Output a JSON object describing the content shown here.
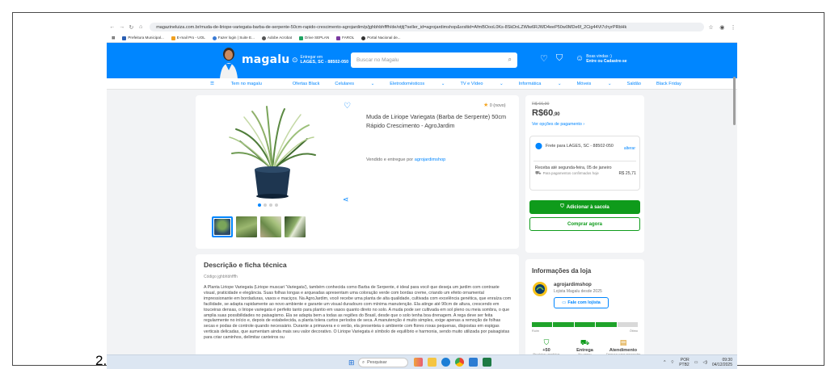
{
  "list_number": "2.",
  "browser": {
    "url": "magazineluiza.com.br/muda-de-liriope-variegata-barba-de-serpente-50cm-rapido-crescimento-agrojardim/p/jghbhbhfffh/de/otjtj?seller_id=agrojardimshop&srsltid=AfmBOooL0Ks-8SkDnLZWlw6RJWD4eeP50w0MDe6f_2Cig44Vi7chyrPRbHk",
    "bookmarks": [
      "Prefeitura Municipal...",
      "E-mail Pro - UOL",
      "Fazer login | Suite E...",
      "Adobe Acrobat",
      "Drive SEPLAN",
      "FAROL",
      "Portal Nacional de..."
    ]
  },
  "header": {
    "logo": "magalu",
    "deliver_label": "Entregar em",
    "deliver_location": "LAGES, SC - 88502-050",
    "search_placeholder": "Buscar no Magalu",
    "login_greeting": "Boas vindas :)",
    "login_action": "Entre ou Cadastre-se"
  },
  "nav": {
    "items": [
      "Tem no magalu",
      "Ofertas Black",
      "Celulares",
      "Eletrodomésticos",
      "TV e Vídeo",
      "Informática",
      "Móveis",
      "Saldão",
      "Black Friday"
    ]
  },
  "product": {
    "title": "Muda de Liriope Variegata (Barba de Serpente) 50cm Rápido Crescimento - AgroJardim",
    "rating": "0 (novo)",
    "seller_prefix": "Vendido e entregue por",
    "seller_name": "agrojardimshop"
  },
  "price": {
    "old": "R$ 66,90",
    "main": "R$60",
    "cents": ",90",
    "payment_link": "Ver opções de pagamento",
    "ship_to": "Frete para LAGES, SC - 88502-050",
    "change": "alterar",
    "delivery": "Receba até segunda-feira, 05 de janeiro",
    "delivery_cost": "R$ 25,71",
    "delivery_note": "Para pagamentos confirmados hoje",
    "add_to_cart": "Adicionar à sacola",
    "buy_now": "Comprar agora"
  },
  "description": {
    "title": "Descrição e ficha técnica",
    "code": "Código jghbhbhfffh",
    "text": "A Planta Liriope Variegata (Liriope muscari 'Variegata'), também conhecida como Barba de Serpente, é ideal para você que deseja um jardim com contraste visual, praticidade e elegância. Suas folhas longas e arqueadas apresentam uma coloração verde com bordas creme, criando um efeito ornamental impressionante em bordaduras, vasos e maciços. Na AgroJardim, você recebe uma planta de alta qualidade, cultivada com excelência genética, que enraíza com facilidade, se adapta rapidamente ao novo ambiente e garante um visual duradouro com mínima manutenção. Ela atinge até 90cm de altura, crescendo em touceiras densas, o liriope variegata é perfeito tanto para plantio em vasos quanto direto no solo. A muda pode ser cultivada em sol pleno ou meia sombra, o que amplia suas possibilidades no paisagismo. Ela se adapta bem a todas as regiões do Brasil, desde que o solo tenha boa drenagem. A rega deve ser feita regularmente no início e, depois de estabelecida, a planta tolera curtos períodos de seca. A manutenção é muito simples, exige apenas a remoção de folhas secas e podas de controle quando necessário. Durante a primavera e o verão, ela presenteia o ambiente com flores roxas pequenas, dispostas em espigas verticais delicadas, que aumentam ainda mais seu valor decorativo. O Liriope Variegata é símbolo de equilíbrio e harmonia, sendo muito utilizada por paisagistas para criar caminhos, delimitar canteiros ou"
  },
  "store": {
    "section_title": "Informações da loja",
    "name": "agrojardimshop",
    "since": "Lojista Magalu desde 2025",
    "chat_button": "Fale com lojista",
    "rep_low": "Ruim",
    "rep_high": "Ótimo",
    "rep_colors": [
      "#1fa32a",
      "#1fa32a",
      "#1fa32a",
      "#1fa32a",
      "#d9d9d9"
    ],
    "metrics": [
      {
        "value": "+50",
        "label": "Produtos vendidos",
        "icon": "bag-icon"
      },
      {
        "value": "Entrega",
        "label": "No prazo",
        "icon": "truck-check-icon"
      },
      {
        "value": "Atendimento",
        "label": "Demora para responder",
        "icon": "chat-clock-icon"
      }
    ]
  },
  "taskbar": {
    "search": "Pesquisar",
    "lang": "POR",
    "lang_sub": "PTB2",
    "time": "09:30",
    "date": "04/12/2025"
  },
  "colors": {
    "brand_blue": "#0086ff",
    "buy_green": "#0f9b1b"
  }
}
